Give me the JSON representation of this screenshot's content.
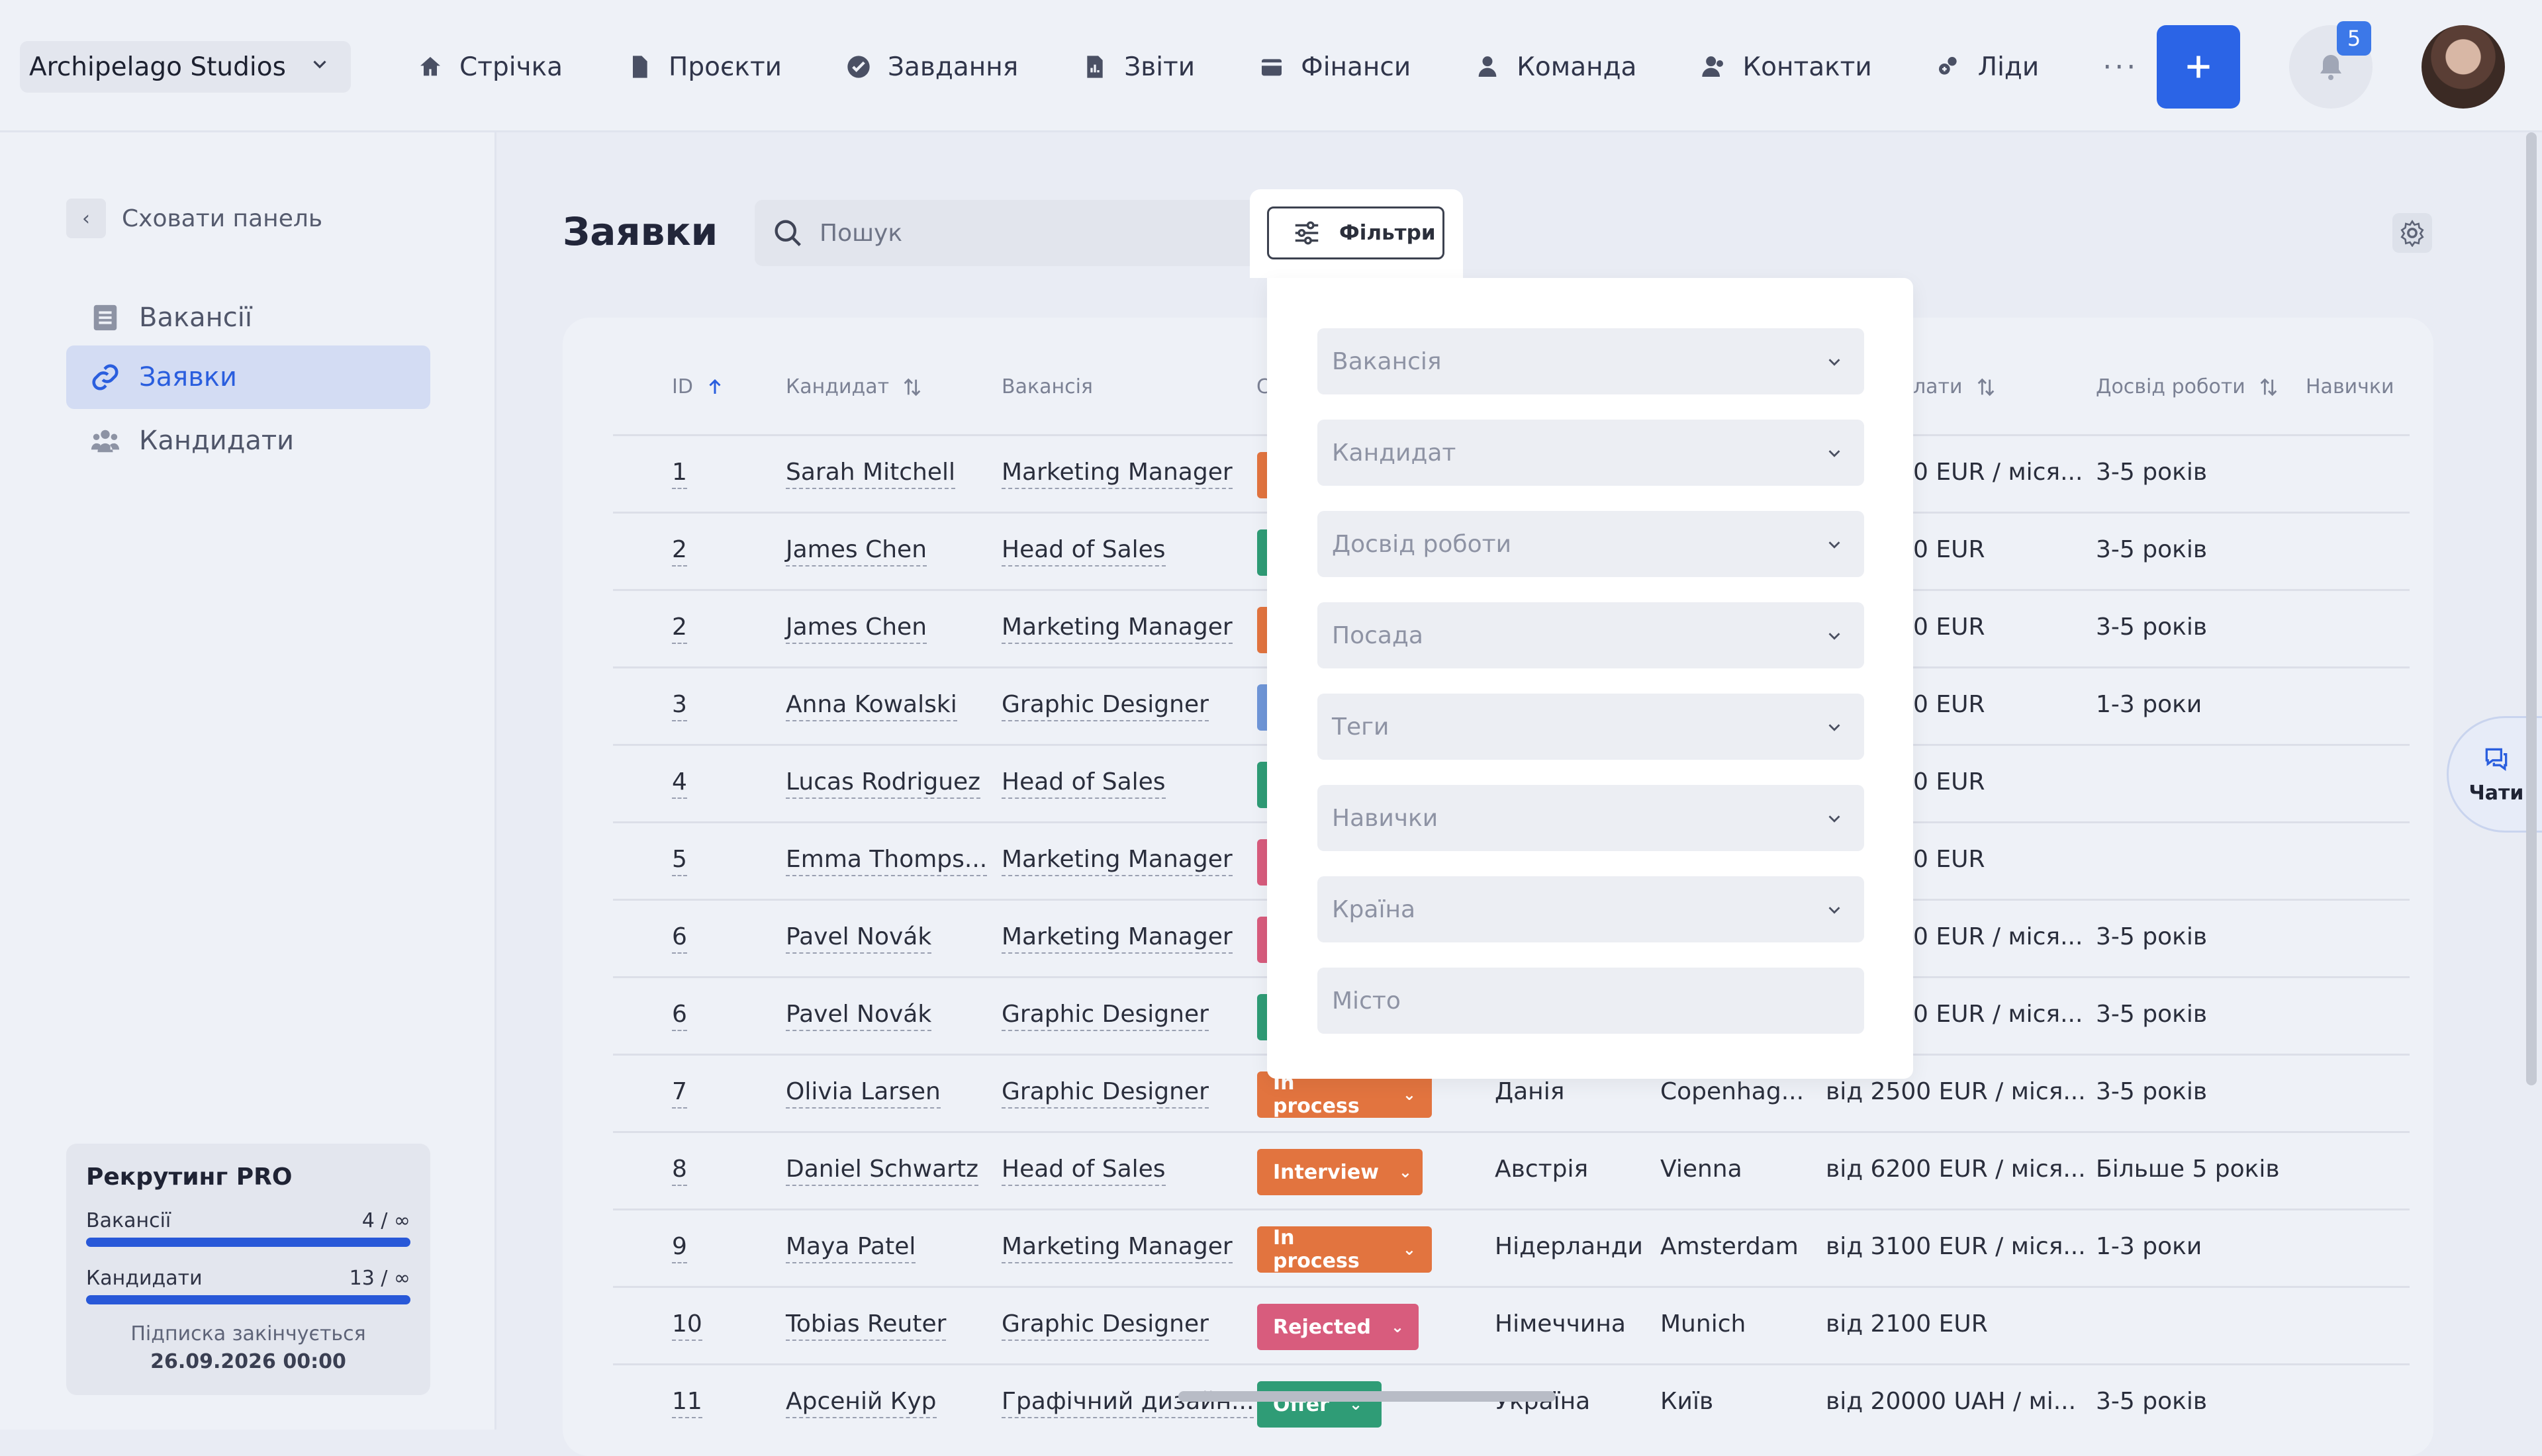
{
  "app": {
    "company": "Archipelago Studios",
    "notifications_count": "5"
  },
  "nav": [
    {
      "label": "Стрічка",
      "icon": "home-icon"
    },
    {
      "label": "Проєкти",
      "icon": "file-icon"
    },
    {
      "label": "Завдання",
      "icon": "check-circle-icon"
    },
    {
      "label": "Звіти",
      "icon": "report-icon"
    },
    {
      "label": "Фінанси",
      "icon": "wallet-icon"
    },
    {
      "label": "Команда",
      "icon": "person-icon"
    },
    {
      "label": "Контакти",
      "icon": "contacts-icon"
    },
    {
      "label": "Ліди",
      "icon": "leads-icon"
    }
  ],
  "nav_more": "···",
  "sidebar": {
    "hide_label": "Сховати панель",
    "items": [
      {
        "label": "Вакансії",
        "icon": "list-icon"
      },
      {
        "label": "Заявки",
        "icon": "link-icon"
      },
      {
        "label": "Кандидати",
        "icon": "people-icon"
      }
    ],
    "plan": {
      "title": "Рекрутинг PRO",
      "vacancies_label": "Вакансії",
      "vacancies_value": "4 / ∞",
      "candidates_label": "Кандидати",
      "candidates_value": "13 / ∞",
      "expires_label": "Підписка закінчується",
      "expires_date": "26.09.2026 00:00"
    }
  },
  "page": {
    "title": "Заявки",
    "search_placeholder": "Пошук",
    "filters_label": "Фільтри"
  },
  "table": {
    "headers": {
      "id": "ID",
      "candidate": "Кандидат",
      "vacancy": "Вакансія",
      "status_partial": "С",
      "salary_partial": "лати",
      "experience": "Досвід роботи",
      "skills": "Навички"
    },
    "rows": [
      {
        "id": "1",
        "candidate": "Sarah Mitchell",
        "vacancy": "Marketing Manager",
        "status": "",
        "status_color": "#e2743f",
        "country": "",
        "city": "",
        "salary": "0 EUR / міся...",
        "experience": "3-5 років"
      },
      {
        "id": "2",
        "candidate": "James Chen",
        "vacancy": "Head of Sales",
        "status": "",
        "status_color": "#2f9c76",
        "country": "",
        "city": "",
        "salary": "0 EUR",
        "experience": "3-5 років"
      },
      {
        "id": "2",
        "candidate": "James Chen",
        "vacancy": "Marketing Manager",
        "status": "",
        "status_color": "#e2743f",
        "country": "",
        "city": "",
        "salary": "0 EUR",
        "experience": "3-5 років"
      },
      {
        "id": "3",
        "candidate": "Anna Kowalski",
        "vacancy": "Graphic Designer",
        "status": "",
        "status_color": "#6f96d8",
        "country": "",
        "city": "",
        "salary": "0 EUR",
        "experience": "1-3 роки"
      },
      {
        "id": "4",
        "candidate": "Lucas Rodriguez",
        "vacancy": "Head of Sales",
        "status": "",
        "status_color": "#2f9c76",
        "country": "",
        "city": "",
        "salary": "0 EUR",
        "experience": ""
      },
      {
        "id": "5",
        "candidate": "Emma Thomps...",
        "vacancy": "Marketing Manager",
        "status": "",
        "status_color": "#d85c7d",
        "country": "",
        "city": "",
        "salary": "0 EUR",
        "experience": ""
      },
      {
        "id": "6",
        "candidate": "Pavel Novák",
        "vacancy": "Marketing Manager",
        "status": "",
        "status_color": "#d85c7d",
        "country": "",
        "city": "",
        "salary": "0 EUR / міся...",
        "experience": "3-5 років"
      },
      {
        "id": "6",
        "candidate": "Pavel Novák",
        "vacancy": "Graphic Designer",
        "status": "",
        "status_color": "#2f9c76",
        "country": "",
        "city": "",
        "salary": "0 EUR / міся...",
        "experience": "3-5 років"
      },
      {
        "id": "7",
        "candidate": "Olivia Larsen",
        "vacancy": "Graphic Designer",
        "status": "In process",
        "status_color": "#e2743f",
        "country": "Данія",
        "city": "Copenhag...",
        "salary": "від 2500 EUR / міся...",
        "experience": "3-5 років"
      },
      {
        "id": "8",
        "candidate": "Daniel Schwartz",
        "vacancy": "Head of Sales",
        "status": "Interview",
        "status_color": "#e2743f",
        "country": "Австрія",
        "city": "Vienna",
        "salary": "від 6200 EUR / міся...",
        "experience": "Більше 5 років"
      },
      {
        "id": "9",
        "candidate": "Maya Patel",
        "vacancy": "Marketing Manager",
        "status": "In process",
        "status_color": "#e2743f",
        "country": "Нідерланди",
        "city": "Amsterdam",
        "salary": "від 3100 EUR / міся...",
        "experience": "1-3 роки"
      },
      {
        "id": "10",
        "candidate": "Tobias Reuter",
        "vacancy": "Graphic Designer",
        "status": "Rejected",
        "status_color": "#d85c7d",
        "country": "Німеччина",
        "city": "Munich",
        "salary": "від 2100 EUR",
        "experience": ""
      },
      {
        "id": "11",
        "candidate": "Арсеній Кур",
        "vacancy": "Графічний дизайн...",
        "status": "Offer",
        "status_color": "#2f9c76",
        "country": "Україна",
        "city": "Київ",
        "salary": "від 20000 UAH / мі...",
        "experience": "3-5 років"
      }
    ]
  },
  "filters_dropdown": {
    "fields": [
      {
        "placeholder": "Вакансія",
        "type": "select"
      },
      {
        "placeholder": "Кандидат",
        "type": "select"
      },
      {
        "placeholder": "Досвід роботи",
        "type": "select"
      },
      {
        "placeholder": "Посада",
        "type": "select"
      },
      {
        "placeholder": "Теги",
        "type": "select"
      },
      {
        "placeholder": "Навички",
        "type": "select"
      },
      {
        "placeholder": "Країна",
        "type": "select"
      },
      {
        "placeholder": "Місто",
        "type": "input"
      }
    ]
  },
  "chat_widget": {
    "label": "Чати"
  }
}
